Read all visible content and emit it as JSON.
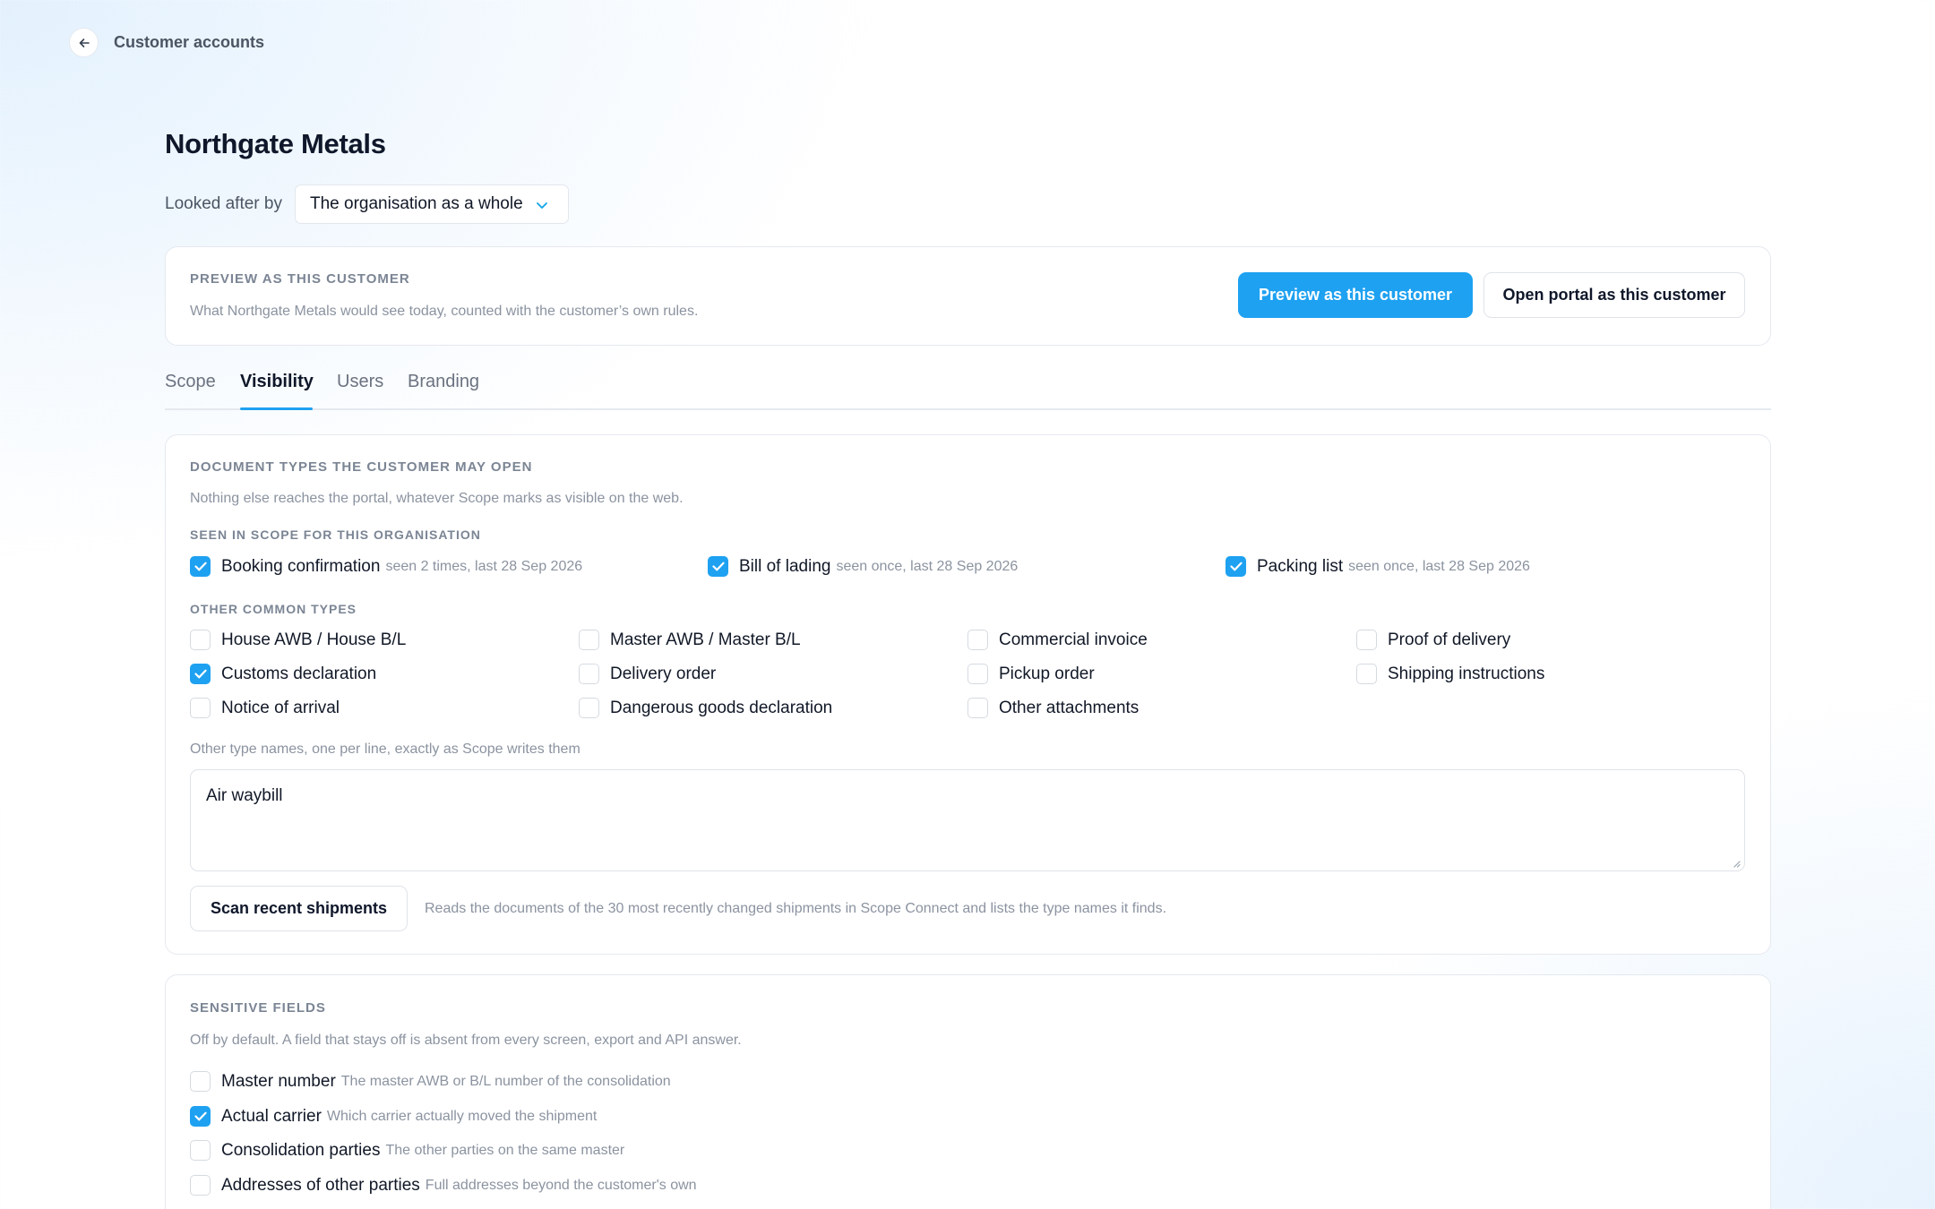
{
  "header": {
    "breadcrumb": "Customer accounts"
  },
  "account": {
    "title": "Northgate Metals",
    "owner_label": "Looked after by",
    "owner_value": "The organisation as a whole"
  },
  "preview": {
    "title": "PREVIEW AS THIS CUSTOMER",
    "description": "What Northgate Metals would see today, counted with the customer’s own rules.",
    "primary_label": "Preview as this customer",
    "secondary_label": "Open portal as this customer"
  },
  "tabs": [
    "Scope",
    "Visibility",
    "Users",
    "Branding"
  ],
  "active_tab": "Visibility",
  "visibility": {
    "title": "DOCUMENT TYPES THE CUSTOMER MAY OPEN",
    "description": "Nothing else reaches the portal, whatever Scope marks as visible on the web.",
    "seen_title": "SEEN IN SCOPE FOR THIS ORGANISATION",
    "seen": [
      {
        "label": "Booking confirmation",
        "hint": "seen 2 times, last 28 Sep 2026",
        "checked": true
      },
      {
        "label": "Bill of lading",
        "hint": "seen once, last 28 Sep 2026",
        "checked": true
      },
      {
        "label": "Packing list",
        "hint": "seen once, last 28 Sep 2026",
        "checked": true
      }
    ],
    "other_title": "OTHER COMMON TYPES",
    "other": [
      {
        "label": "House AWB / House B/L",
        "checked": false
      },
      {
        "label": "Master AWB / Master B/L",
        "checked": false
      },
      {
        "label": "Commercial invoice",
        "checked": false
      },
      {
        "label": "Proof of delivery",
        "checked": false
      },
      {
        "label": "Customs declaration",
        "checked": true
      },
      {
        "label": "Delivery order",
        "checked": false
      },
      {
        "label": "Pickup order",
        "checked": false
      },
      {
        "label": "Shipping instructions",
        "checked": false
      },
      {
        "label": "Notice of arrival",
        "checked": false
      },
      {
        "label": "Dangerous goods declaration",
        "checked": false
      },
      {
        "label": "Other attachments",
        "checked": false
      }
    ],
    "textarea_label": "Other type names, one per line, exactly as Scope writes them",
    "textarea_value": "Air waybill",
    "scan_button": "Scan recent shipments",
    "scan_description": "Reads the documents of the 30 most recently changed shipments in Scope Connect and lists the type names it finds."
  },
  "sensitive": {
    "title": "SENSITIVE FIELDS",
    "description": "Off by default. A field that stays off is absent from every screen, export and API answer.",
    "fields": [
      {
        "label": "Master number",
        "hint": "The master AWB or B/L number of the consolidation",
        "checked": false
      },
      {
        "label": "Actual carrier",
        "hint": "Which carrier actually moved the shipment",
        "checked": true
      },
      {
        "label": "Consolidation parties",
        "hint": "The other parties on the same master",
        "checked": false
      },
      {
        "label": "Addresses of other parties",
        "hint": "Full addresses beyond the customer's own",
        "checked": false
      }
    ]
  },
  "colors": {
    "accent": "#1ea1f1",
    "muted": "#8b93a0"
  }
}
